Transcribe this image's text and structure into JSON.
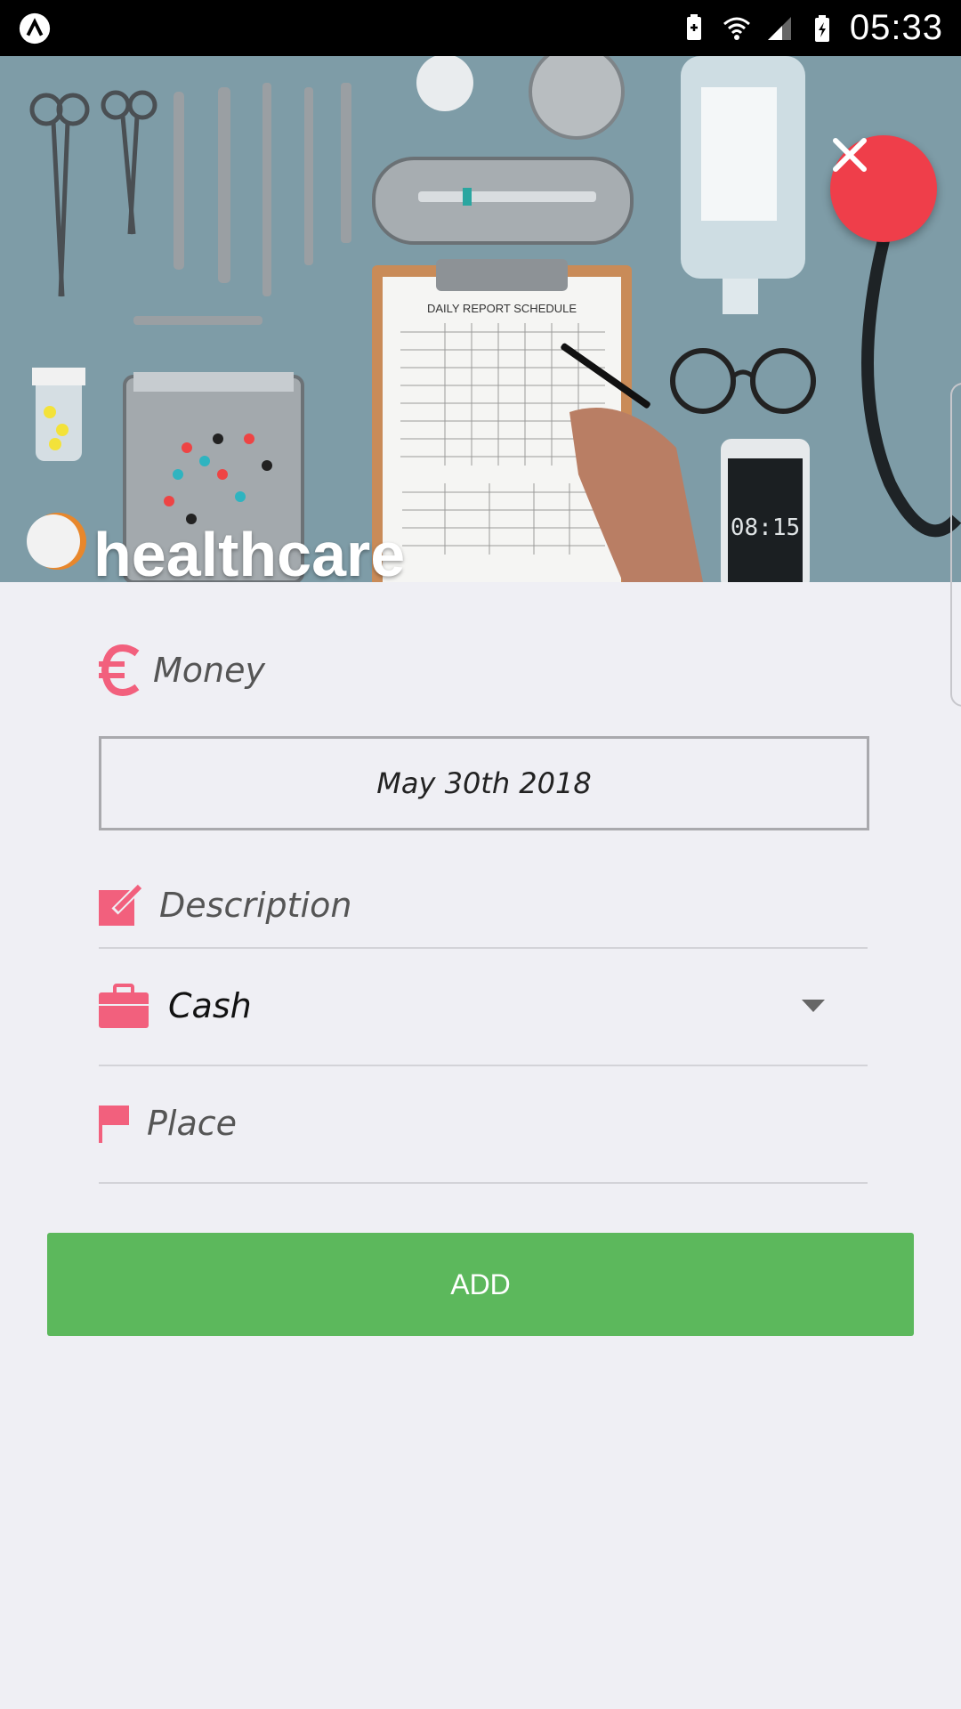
{
  "status_bar": {
    "time": "05:33"
  },
  "header": {
    "category_title": "healthcare",
    "photo_texts": {
      "clipboard_title": "DAILY REPORT SCHEDULE",
      "phone_clock": "08:15"
    }
  },
  "form": {
    "amount_placeholder": "Money",
    "date_value": "May 30th 2018",
    "description_placeholder": "Description",
    "payment_method_selected": "Cash",
    "place_placeholder": "Place",
    "submit_label": "ADD"
  },
  "colors": {
    "accent_pink": "#f2607d",
    "close_red": "#ef3e4a",
    "add_green": "#5cb85c",
    "background": "#efeff4"
  }
}
